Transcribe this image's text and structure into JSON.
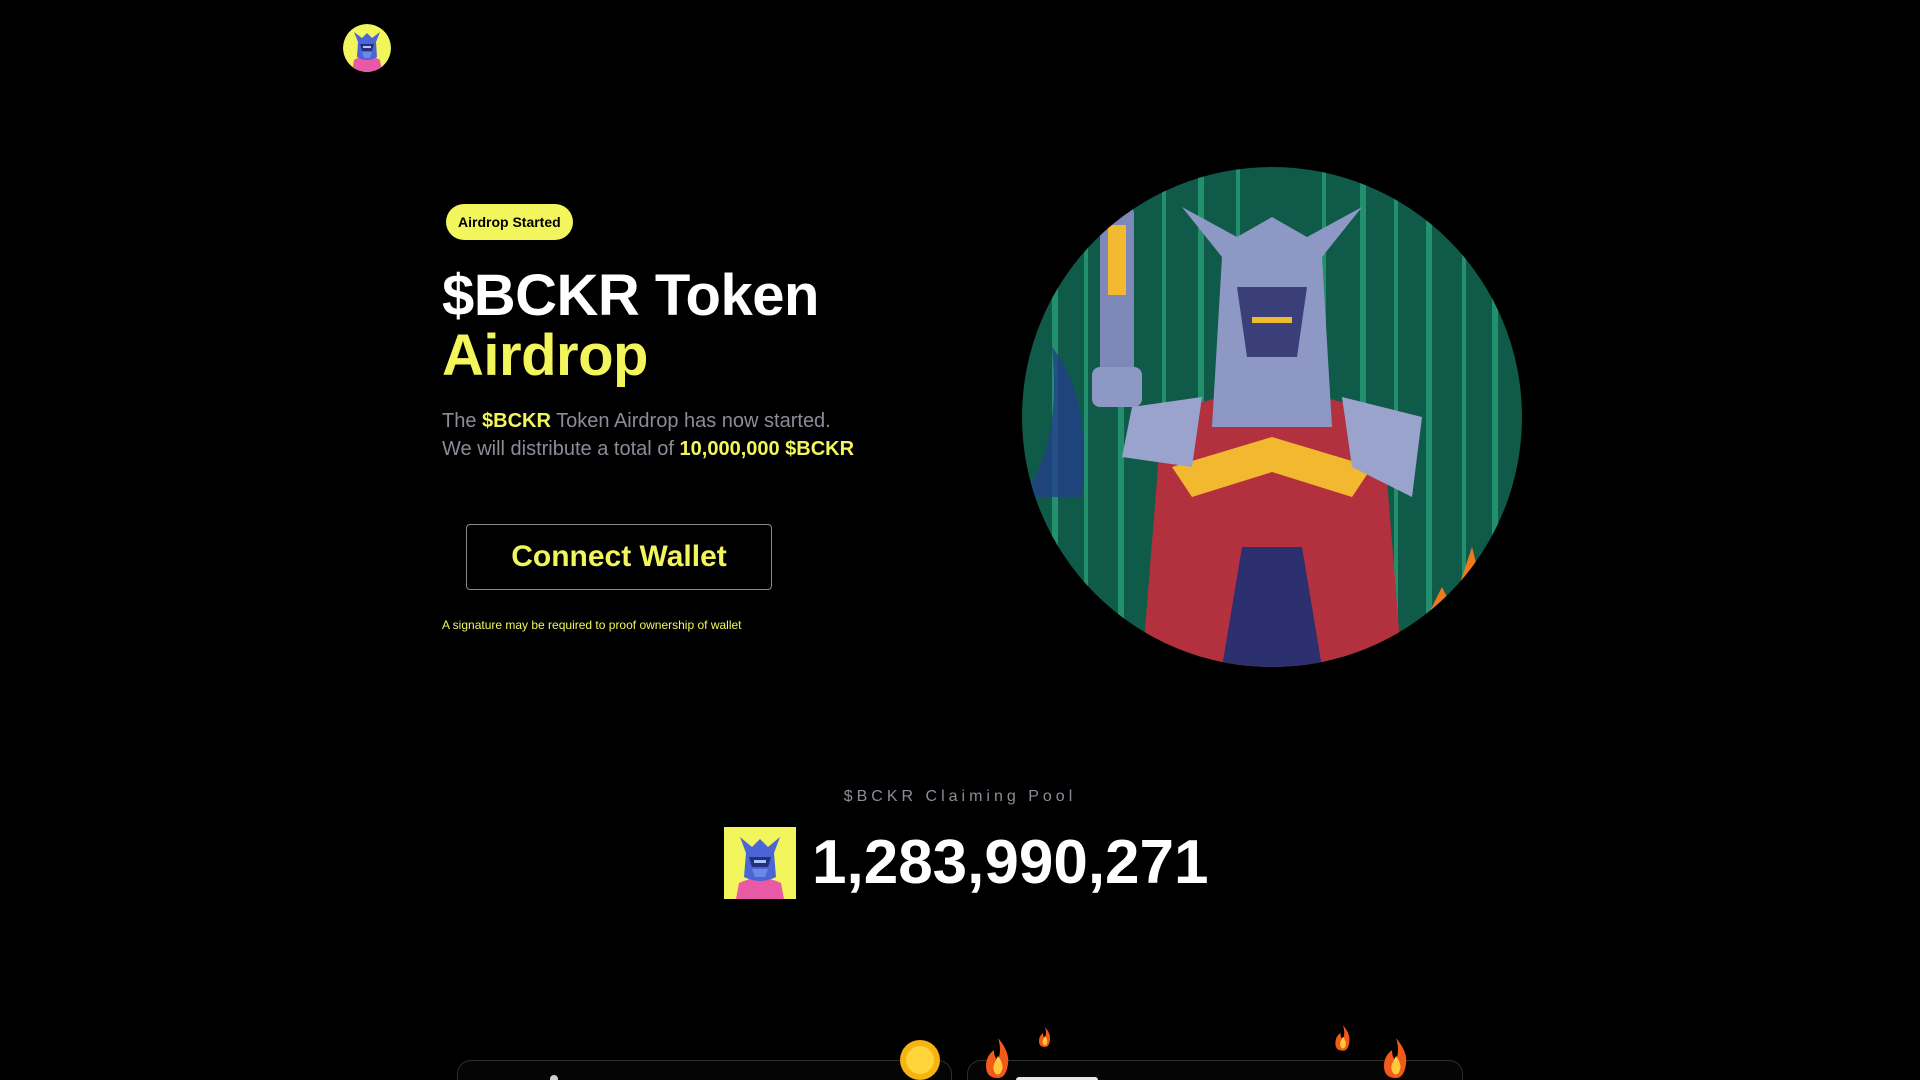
{
  "header": {
    "logo_icon": "avatar-logo-icon"
  },
  "hero": {
    "badge": "Airdrop Started",
    "title_line1": "$BCKR Token",
    "title_line2": "Airdrop",
    "desc_line1_prefix": "The",
    "desc_line1_token": "$BCKR",
    "desc_line1_suffix": "Token Airdrop has now started.",
    "desc_line2_prefix": "We will distribute a total of",
    "desc_line2_amount": "10,000,000 $BCKR",
    "connect_button": "Connect Wallet",
    "signature_note": "A signature may be required to proof ownership of wallet",
    "art_icon": "armored-robot-character-art"
  },
  "pool": {
    "label": "$BCKR Claiming Pool",
    "value": "1,283,990,271",
    "icon": "token-avatar-icon"
  },
  "decorations": {
    "coin_icon": "gold-coin-icon",
    "flame_icon": "flame-icon"
  },
  "colors": {
    "accent": "#f2f55b",
    "background": "#000000",
    "muted_text": "#8c8c99",
    "matrix_bg": "#0f5a48"
  }
}
